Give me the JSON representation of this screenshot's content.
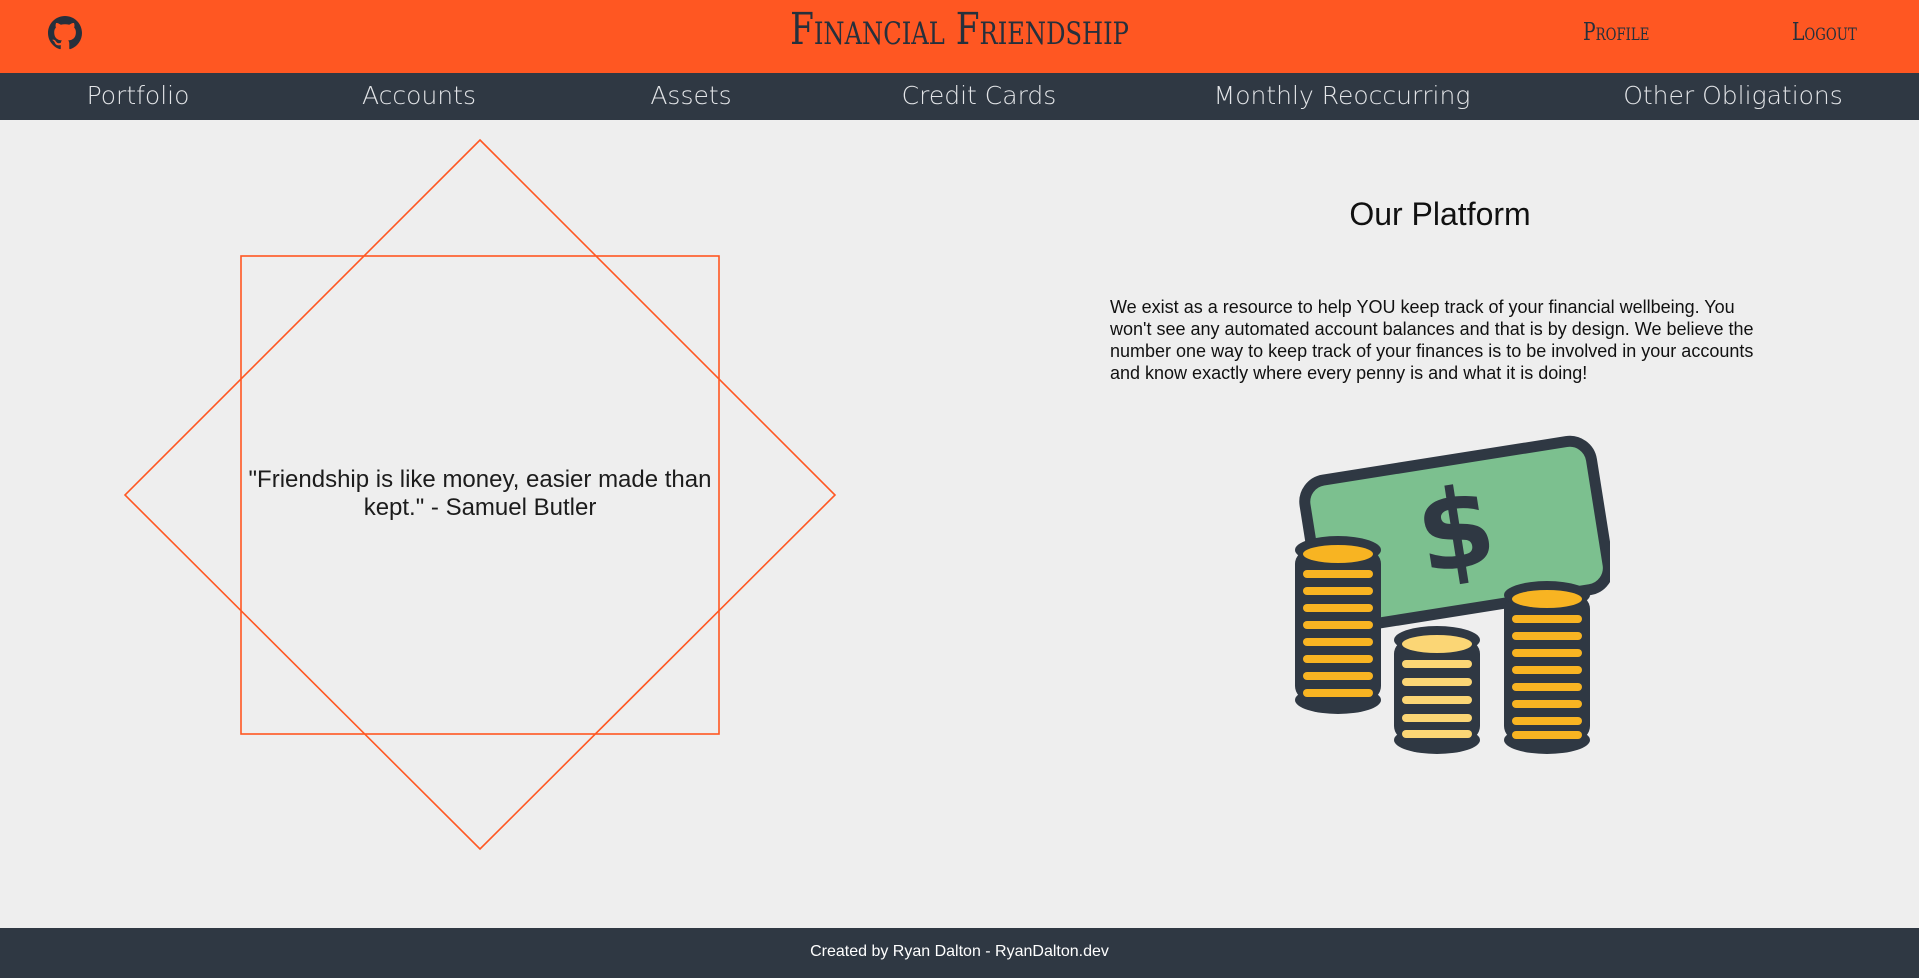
{
  "header": {
    "brand": "Financial Friendship",
    "links": {
      "profile": "Profile",
      "logout": "Logout"
    }
  },
  "nav": {
    "items": [
      "Portfolio",
      "Accounts",
      "Assets",
      "Credit Cards",
      "Monthly Reoccurring",
      "Other Obligations"
    ]
  },
  "main": {
    "quote": "\"Friendship is like money, easier made than kept.\" - Samuel Butler",
    "platform": {
      "title": "Our Platform",
      "body": "We exist as a resource to help YOU keep track of your financial wellbeing. You won't see any automated account balances and that is by design. We believe the number one way to keep track of your finances is to be involved in your accounts and know exactly where every penny is and what it is doing!"
    }
  },
  "footer": {
    "credit": "Created by Ryan Dalton - RyanDalton.dev"
  },
  "icons": {
    "github": "github-icon",
    "money": "money-coins-illustration"
  },
  "colors": {
    "accent": "#ff5722",
    "nav_bg": "#2f3843",
    "page_bg": "#eeeeee",
    "bill": "#7cc08f",
    "coin": "#f8b422"
  }
}
